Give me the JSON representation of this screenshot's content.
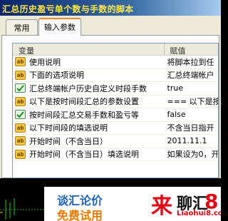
{
  "window": {
    "title": "汇总历史盈亏单个数与手数的脚本"
  },
  "tabs": [
    {
      "label": "常用"
    },
    {
      "label": "输入参数"
    }
  ],
  "grid": {
    "headers": {
      "variable": "变量",
      "value": "赋值"
    },
    "rows": [
      {
        "icon": "string-type-icon",
        "icon_text": "ab",
        "label": "使用说明",
        "value": "将脚本拉到任"
      },
      {
        "icon": "string-type-icon",
        "icon_text": "ab",
        "label": "下面的选项说明",
        "value": "汇总终端帐户"
      },
      {
        "icon": "boolean-type-icon",
        "icon_text": "",
        "label": "汇总终端帐户历史自定义时段手数",
        "value": "true"
      },
      {
        "icon": "string-type-icon",
        "icon_text": "ab",
        "label": "以下是按时间段汇总的参数设置",
        "value": "=== 以下是按"
      },
      {
        "icon": "boolean-type-icon",
        "icon_text": "",
        "label": "按时间段汇总交易手数和盈亏等",
        "value": "false"
      },
      {
        "icon": "string-type-icon",
        "icon_text": "ab",
        "label": "以下时间段的填选说明",
        "value": "不含当日指开"
      },
      {
        "icon": "string-type-icon",
        "icon_text": "ab",
        "label": "开始时间（不含当日）",
        "value": "2011.11.1"
      },
      {
        "icon": "string-type-icon",
        "icon_text": "ab",
        "label": "开始时间（不含当日）填选说明",
        "value": "如果设为0，开"
      }
    ]
  },
  "banner": {
    "line1": "谈汇论价",
    "line2": "免费试用",
    "big_char": "来",
    "name": "聊汇",
    "number": "8",
    "url": "Liaohui8.com"
  },
  "colors": {
    "title_text": "#ffe83a",
    "tab_accent": "#e68b2c",
    "banner_blue": "#1c63b7",
    "banner_orange": "#e67a00",
    "banner_red": "#e60012"
  }
}
